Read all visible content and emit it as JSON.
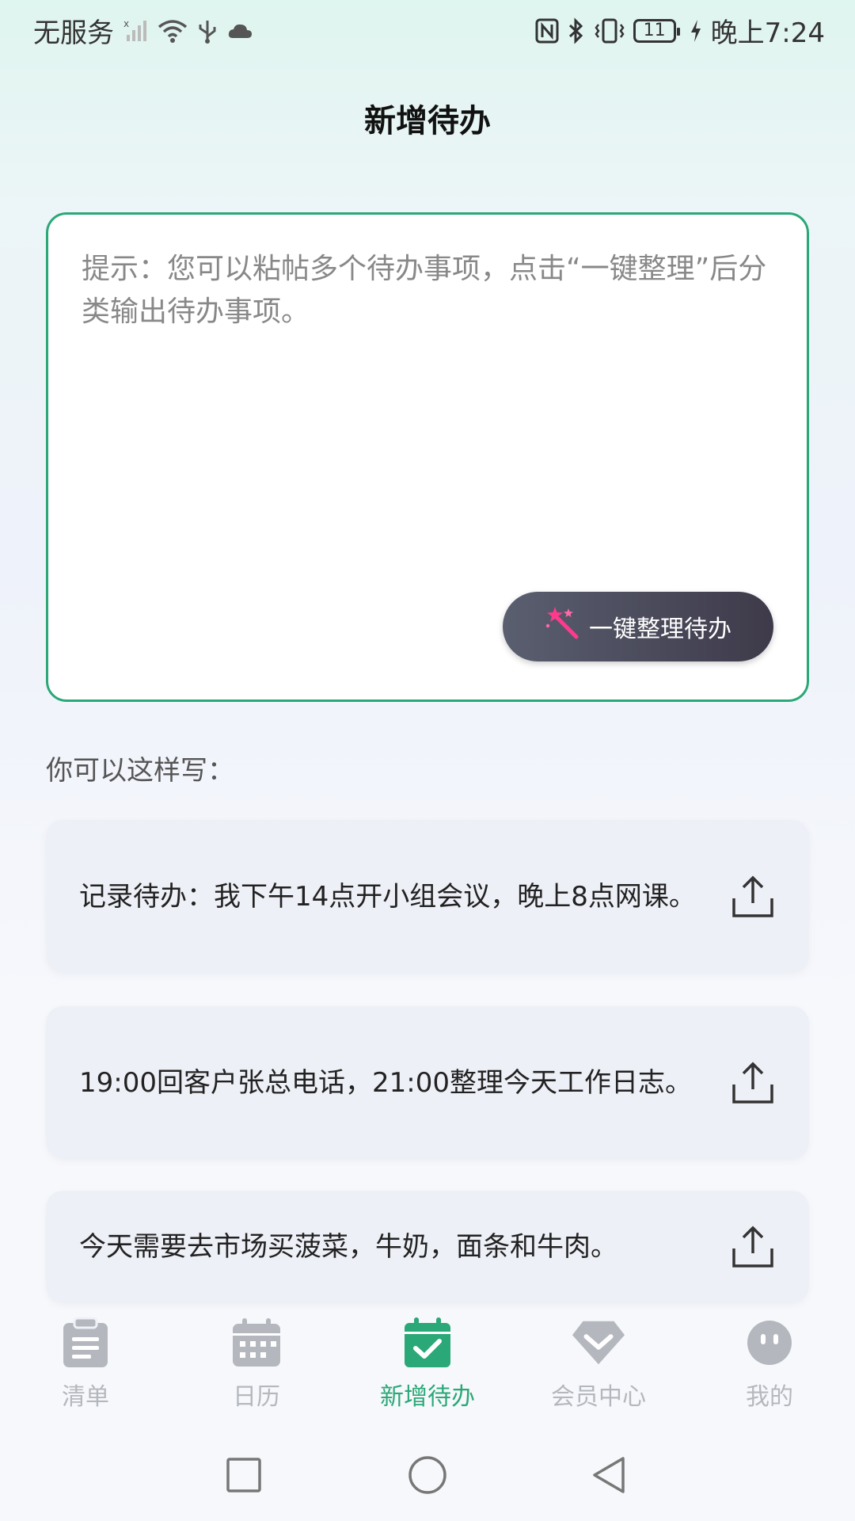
{
  "status_bar": {
    "carrier": "无服务",
    "battery": "11",
    "time": "晚上7:24",
    "icons": [
      "signal-icon",
      "wifi-icon",
      "usb-icon",
      "cloud-icon",
      "nfc-icon",
      "bluetooth-icon",
      "vibrate-icon",
      "battery-icon",
      "charging-icon"
    ]
  },
  "header": {
    "title": "新增待办"
  },
  "input": {
    "placeholder": "提示：您可以粘帖多个待办事项，点击“一键整理”后分类输出待办事项。",
    "value": "",
    "organize_label": "一键整理待办",
    "organize_icon": "magic-wand-icon"
  },
  "examples": {
    "label": "你可以这样写：",
    "items": [
      {
        "text": "记录待办：我下午14点开小组会议，晚上8点网课。"
      },
      {
        "text": "19:00回客户张总电话，21:00整理今天工作日志。"
      },
      {
        "text": "今天需要去市场买菠菜，牛奶，面条和牛肉。"
      }
    ]
  },
  "tabs": [
    {
      "label": "清单",
      "icon": "clipboard-icon",
      "active": false
    },
    {
      "label": "日历",
      "icon": "calendar-icon",
      "active": false
    },
    {
      "label": "新增待办",
      "icon": "calendar-check-icon",
      "active": true
    },
    {
      "label": "会员中心",
      "icon": "diamond-icon",
      "active": false
    },
    {
      "label": "我的",
      "icon": "face-icon",
      "active": false
    }
  ],
  "colors": {
    "accent": "#2aa877",
    "inactive": "#b4b8be",
    "button_bg": "#4a4a5a"
  }
}
